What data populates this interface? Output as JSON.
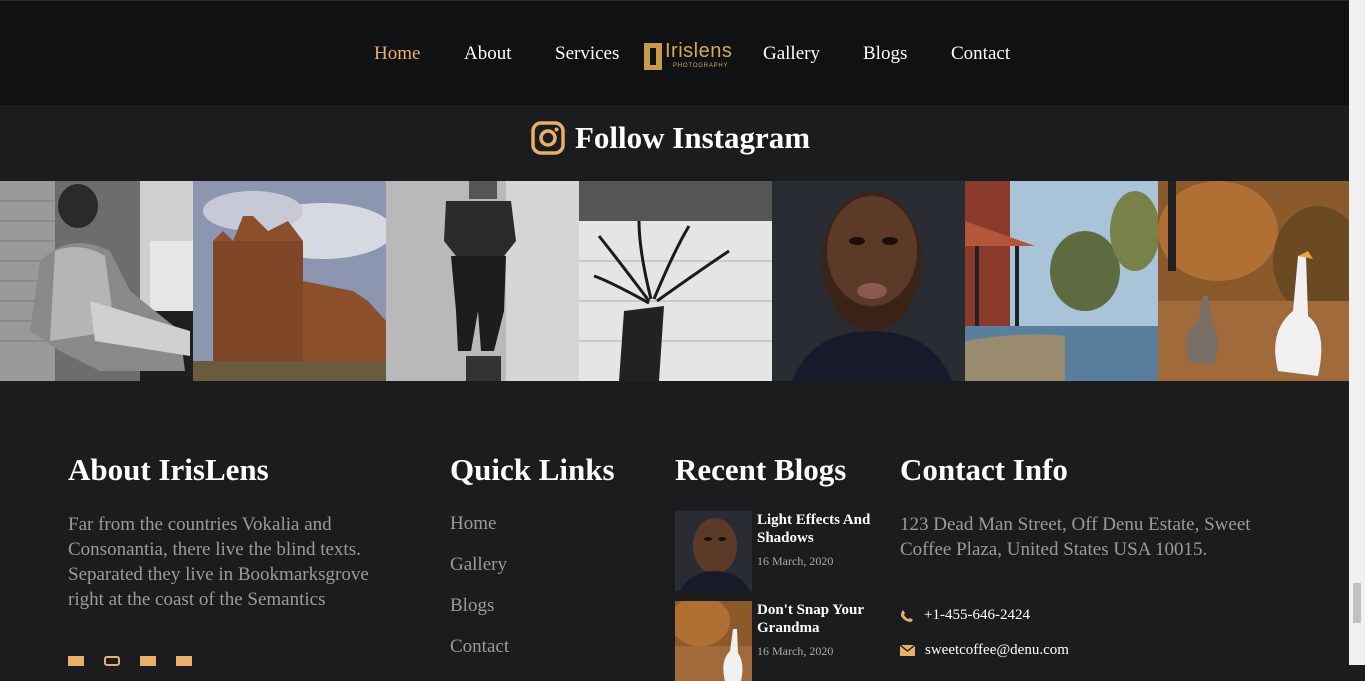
{
  "nav": {
    "items": [
      "Home",
      "About",
      "Services",
      "Gallery",
      "Blogs",
      "Contact"
    ],
    "active": "Home",
    "logo_word": "Irislens",
    "logo_sub": "PHOTOGRAPHY"
  },
  "instagram": {
    "title": "Follow Instagram",
    "icon": "instagram-icon"
  },
  "footer": {
    "about": {
      "heading": "About IrisLens",
      "text": "Far from the countries Vokalia and Consonantia, there live the blind texts. Separated they live in Bookmarksgrove right at the coast of the Semantics"
    },
    "quick_links": {
      "heading": "Quick Links",
      "items": [
        "Home",
        "Gallery",
        "Blogs",
        "Contact"
      ]
    },
    "recent_blogs": {
      "heading": "Recent Blogs",
      "items": [
        {
          "title": "Light Effects And Shadows",
          "date": "16 March, 2020"
        },
        {
          "title": "Don't Snap Your Grandma",
          "date": "16 March, 2020"
        }
      ]
    },
    "contact": {
      "heading": "Contact Info",
      "address": "123 Dead Man Street, Off Denu Estate, Sweet Coffee Plaza, United States USA 10015.",
      "phone": "+1-455-646-2424",
      "email": "sweetcoffee@denu.com",
      "phone_icon": "phone-icon",
      "email_icon": "envelope-icon"
    }
  },
  "colors": {
    "accent": "#e8b06b",
    "nav_bg": "#101112",
    "page_bg": "#1b1c1e",
    "muted_text": "#9b9b9b"
  }
}
